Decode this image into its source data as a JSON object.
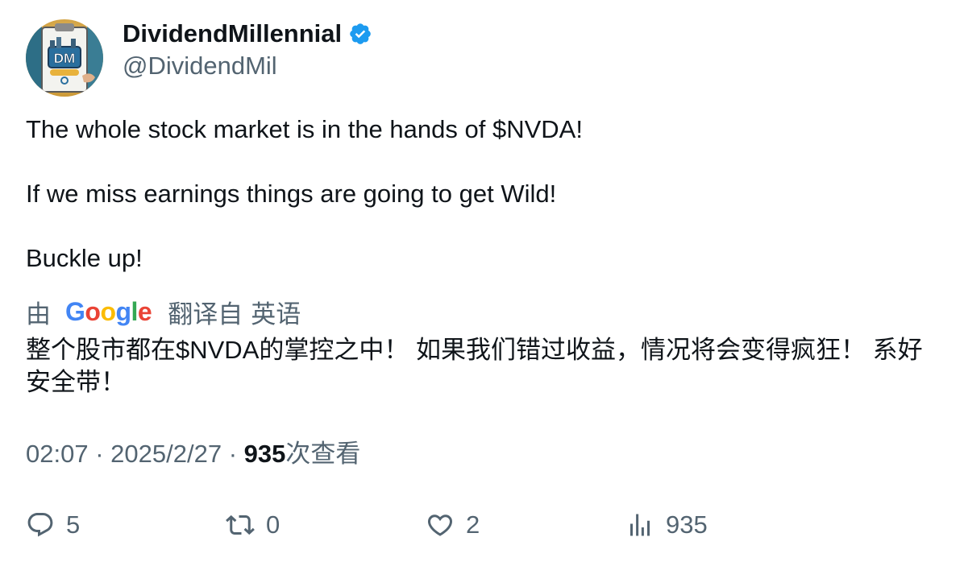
{
  "author": {
    "display_name": "DividendMillennial",
    "handle": "@DividendMil",
    "avatar_text": "DM",
    "verified_icon": "verified-badge-icon"
  },
  "tweet": {
    "lines": [
      "The whole stock market is in the hands of $NVDA!",
      "If we miss earnings things are going to get Wild!",
      "Buckle up!"
    ],
    "translation": {
      "by_label": "由",
      "provider": "Google",
      "from_label": "翻译自",
      "language": "英语",
      "text": "整个股市都在$NVDA的掌控之中！ 如果我们错过收益，情况将会变得疯狂！ 系好安全带！"
    },
    "time": "02:07",
    "date": "2025/2/27",
    "separator": "·",
    "views_count": "935",
    "views_label": "次查看"
  },
  "actions": {
    "replies": "5",
    "retweets": "0",
    "likes": "2",
    "views": "935"
  },
  "colors": {
    "text": "#0f1419",
    "secondary": "#536471",
    "verified": "#1d9bf0"
  }
}
